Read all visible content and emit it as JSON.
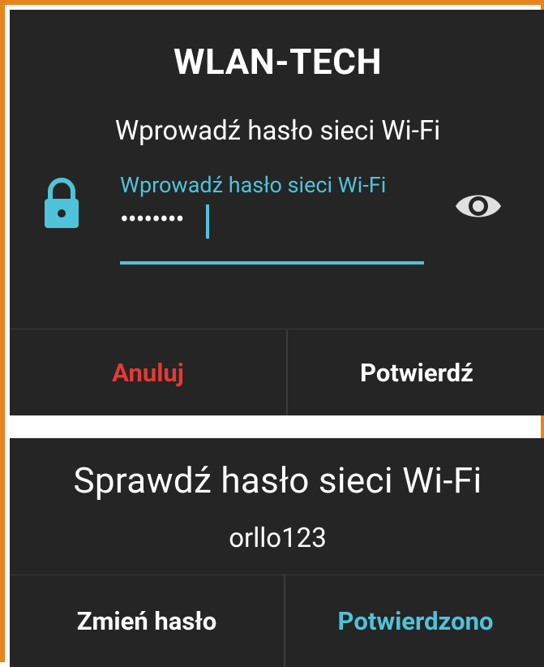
{
  "colors": {
    "frame_border": "#e8841e",
    "dialog_background": "#252525",
    "accent": "#4fc3d9",
    "cancel": "#e53935",
    "text": "#ffffff",
    "divider": "#3a3a3a"
  },
  "password_dialog": {
    "title": "WLAN-TECH",
    "message": "Wprowadź hasło sieci Wi-Fi",
    "input": {
      "label": "Wprowadź hasło sieci Wi-Fi",
      "masked_value": "••••••••",
      "leading_icon": "lock-icon",
      "trailing_icon": "eye-icon"
    },
    "buttons": {
      "cancel": "Anuluj",
      "confirm": "Potwierdź"
    }
  },
  "verify_dialog": {
    "title": "Sprawdź hasło sieci Wi-Fi",
    "password": "orllo123",
    "buttons": {
      "change": "Zmień hasło",
      "confirmed": "Potwierdzono"
    }
  }
}
